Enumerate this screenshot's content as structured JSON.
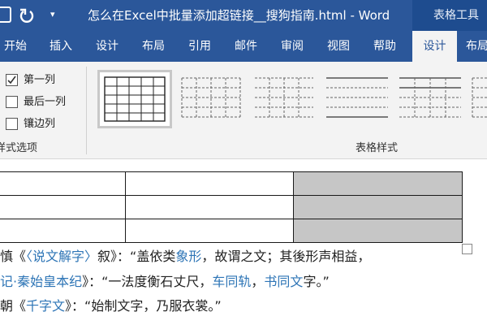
{
  "window": {
    "title": "怎么在Excel中批量添加超链接__搜狗指南.html  -  Word",
    "context_tab": "表格工具",
    "quick_access_more": "▾"
  },
  "ribbon_tabs": [
    {
      "label": "开始",
      "active": false
    },
    {
      "label": "插入",
      "active": false
    },
    {
      "label": "设计",
      "active": false
    },
    {
      "label": "布局",
      "active": false
    },
    {
      "label": "引用",
      "active": false
    },
    {
      "label": "邮件",
      "active": false
    },
    {
      "label": "审阅",
      "active": false
    },
    {
      "label": "视图",
      "active": false
    },
    {
      "label": "帮助",
      "active": false
    },
    {
      "label": "设计",
      "active": true
    },
    {
      "label": "布局",
      "active": false
    }
  ],
  "style_options": {
    "items": [
      {
        "label": "第一列",
        "checked": true
      },
      {
        "label": "最后一列",
        "checked": false
      },
      {
        "label": "镶边列",
        "checked": false
      }
    ],
    "group_label": "样式选项"
  },
  "table_styles": {
    "group_label": "表格样式",
    "selected_index": 0
  },
  "document": {
    "table": {
      "rows": 3,
      "cols": 3,
      "shaded_column": 2
    },
    "lines": [
      [
        {
          "text": "慎《",
          "link": false
        },
        {
          "text": "〈说文解字〉",
          "link": true
        },
        {
          "text": "叙》：“盖依类",
          "link": false
        },
        {
          "text": "象形",
          "link": true
        },
        {
          "text": "，故谓之文；其後形声相益，",
          "link": false
        }
      ],
      [
        {
          "text": "记·秦始皇本纪",
          "link": true
        },
        {
          "text": "》：“一法度衡石丈尺，",
          "link": false
        },
        {
          "text": "车同轨",
          "link": true
        },
        {
          "text": "，",
          "link": false
        },
        {
          "text": "书同文",
          "link": true
        },
        {
          "text": "字。”",
          "link": false
        }
      ],
      [
        {
          "text": "朝《",
          "link": false
        },
        {
          "text": "千字文",
          "link": true
        },
        {
          "text": "》：“始制文字，乃服衣裳。”",
          "link": false
        }
      ]
    ]
  },
  "colors": {
    "word_blue": "#2b579a",
    "context_blue": "#1e4c8f",
    "ribbon_bg": "#f3f3f3",
    "link": "#2e75b6",
    "shaded_cell": "#c6c6c6"
  },
  "icons": [
    "save-icon",
    "undo-icon",
    "checkmark-icon",
    "table-style-thumbnail"
  ]
}
